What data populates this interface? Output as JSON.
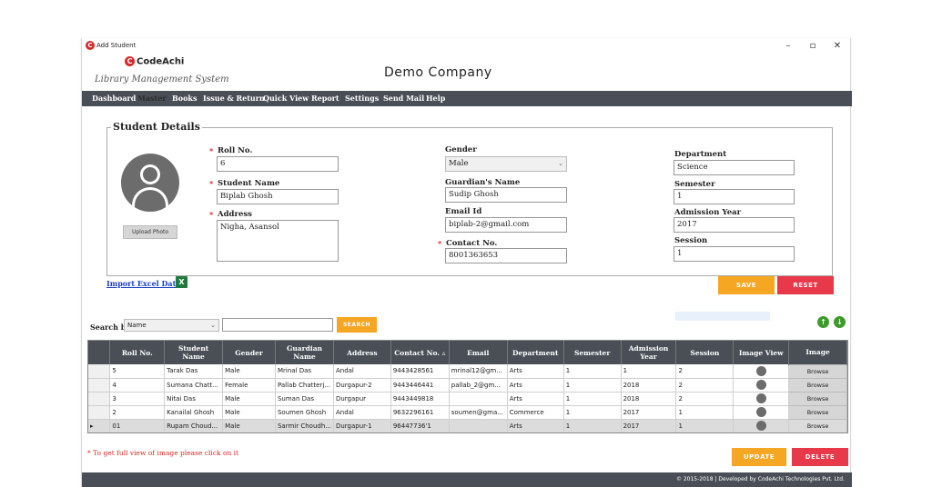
{
  "window": {
    "title": "Add Student",
    "minimize": "–",
    "maximize": "▫",
    "close": "✕"
  },
  "header": {
    "logo_text": "CodeAchi",
    "logo_letter": "C",
    "tagline": "Library Management System",
    "company": "Demo Company"
  },
  "menu": [
    "Dashboard",
    "Master",
    "Books",
    "Issue & Return",
    "Quick View",
    "Report",
    "Settings",
    "Send Mail",
    "Help"
  ],
  "form": {
    "legend": "Student Details",
    "upload_photo": "Upload Photo",
    "required_mark": "*",
    "roll_no": {
      "label": "Roll No.",
      "value": "6"
    },
    "student_name": {
      "label": "Student Name",
      "value": "Biplab Ghosh"
    },
    "address": {
      "label": "Address",
      "value": "Nigha, Asansol"
    },
    "gender": {
      "label": "Gender",
      "value": "Male"
    },
    "guardian_name": {
      "label": "Guardian's Name",
      "value": "Sudip Ghosh"
    },
    "email": {
      "label": "Email Id",
      "value": "biplab-2@gmail.com"
    },
    "contact": {
      "label": "Contact No.",
      "value": "8001363653"
    },
    "department": {
      "label": "Department",
      "value": "Science"
    },
    "semester": {
      "label": "Semester",
      "value": "1"
    },
    "admission_year": {
      "label": "Admission Year",
      "value": "2017"
    },
    "session": {
      "label": "Session",
      "value": "1"
    },
    "import_excel": "Import Excel Data",
    "excel_icon": "X",
    "save": "SAVE",
    "reset": "RESET"
  },
  "search": {
    "label": "Search by",
    "field": "Name",
    "query": "",
    "button": "SEARCH"
  },
  "table": {
    "columns": [
      "Roll No.",
      "Student Name",
      "Gender",
      "Guardian Name",
      "Address",
      "Contact No.",
      "Email",
      "Department",
      "Semester",
      "Admission Year",
      "Session",
      "Image View",
      "Image"
    ],
    "sort_indicator": "▵",
    "selected_marker": "▸",
    "browse_label": "Browse",
    "rows": [
      [
        "5",
        "Tarak Das",
        "Male",
        "Mrinal Das",
        "Andal",
        "9443428561",
        "mrinal12@gm...",
        "Arts",
        "1",
        "1",
        "2"
      ],
      [
        "4",
        "Sumana Chatt...",
        "Female",
        "Pallab Chatterj...",
        "Durgapur-2",
        "9443446441",
        "pallab_2@gm...",
        "Arts",
        "1",
        "2018",
        "2"
      ],
      [
        "3",
        "Nitai Das",
        "Male",
        "Suman Das",
        "Durgapur",
        "9443449818",
        "",
        "Arts",
        "1",
        "2018",
        "2"
      ],
      [
        "2",
        "Kanailal Ghosh",
        "Male",
        "Soumen Ghosh",
        "Andal",
        "9632296161",
        "soumen@gma...",
        "Commerce",
        "1",
        "2017",
        "1"
      ],
      [
        "01",
        "Rupam Choud...",
        "Male",
        "Sarmir Choudh...",
        "Durgapur-1",
        "96447736'1",
        "",
        "Arts",
        "1",
        "2017",
        "1"
      ]
    ]
  },
  "note": "* To get full view of image please click on it",
  "update": "UPDATE",
  "delete": "DELETE",
  "footer": "© 2015-2018 | Developed by CodeAchi Technologies Pvt. Ltd.",
  "colors": {
    "menubar": "#4a4f57",
    "accent_orange": "#f5a623",
    "accent_red": "#e8394a",
    "brand_red": "#d42a2a"
  }
}
